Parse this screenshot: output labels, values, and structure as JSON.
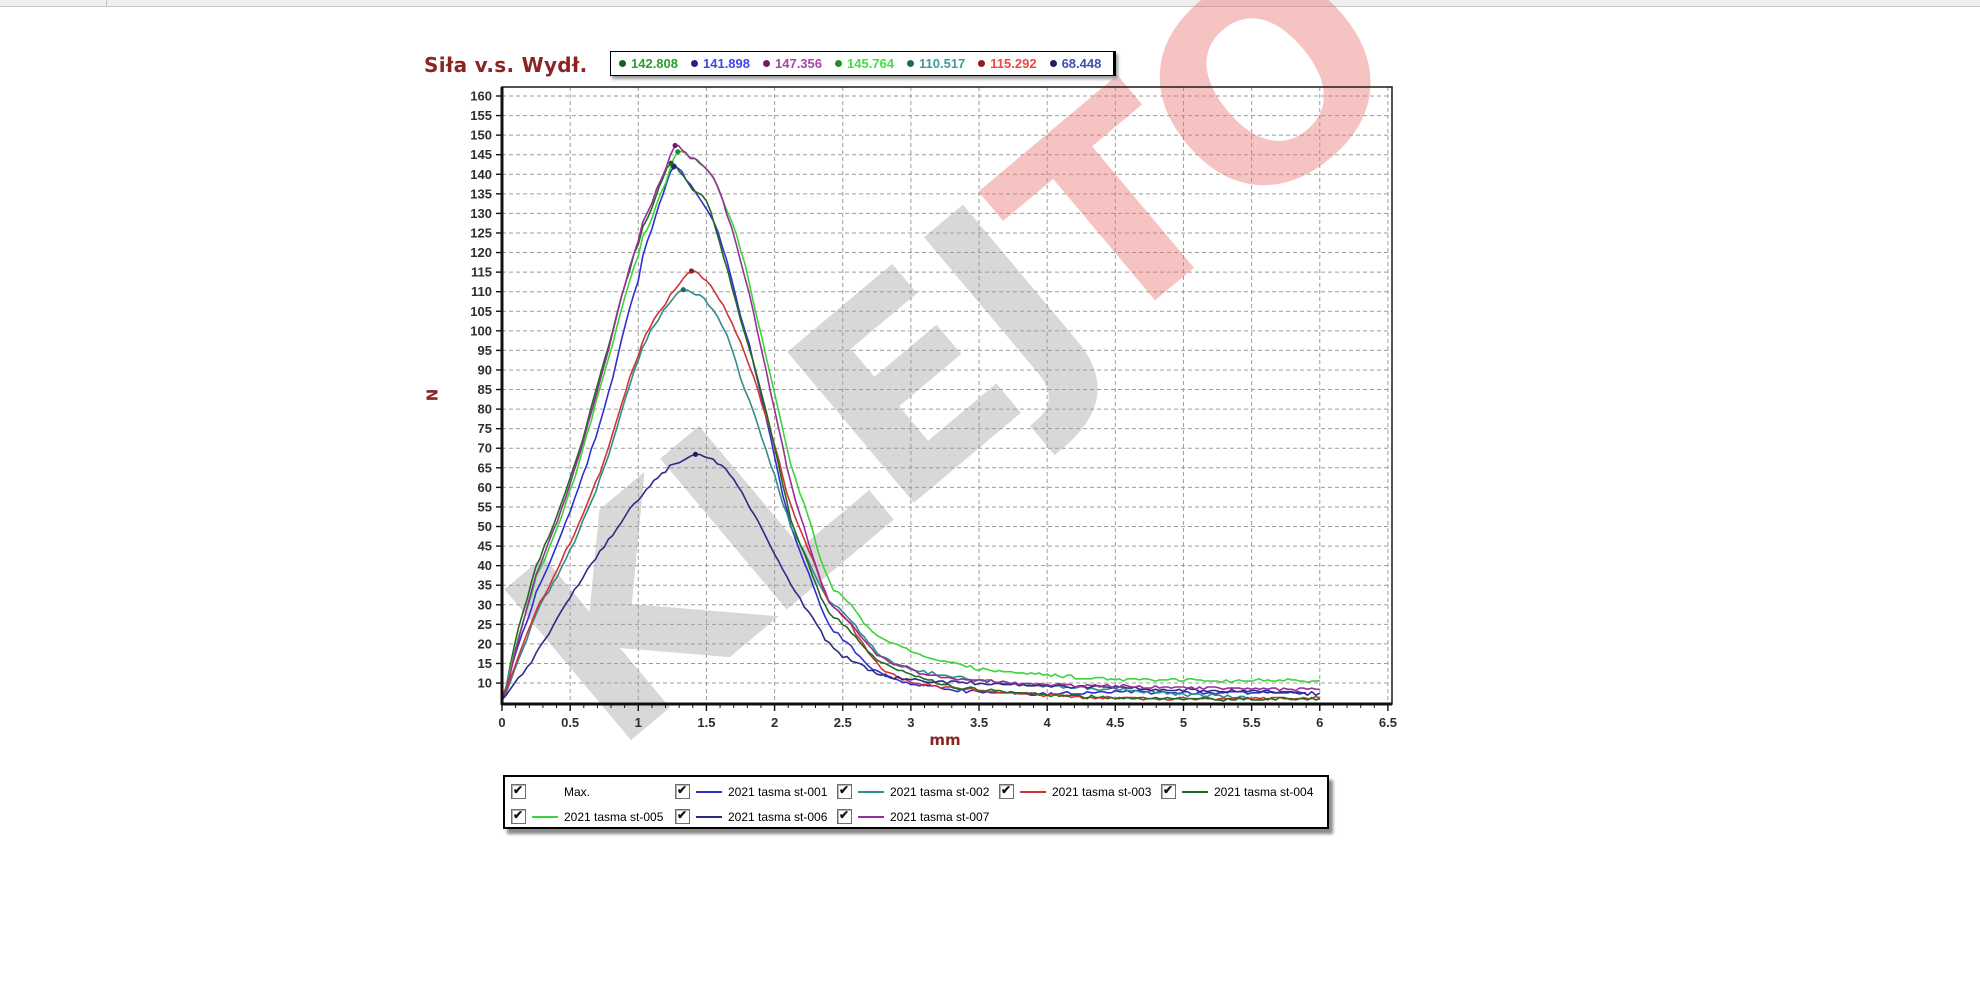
{
  "title": "Siła v.s. Wydł.",
  "axes": {
    "y_label": "N",
    "x_label": "mm"
  },
  "watermark": {
    "gray": "KLEJ",
    "red": "TO",
    "gray_color": "rgba(158,158,158,0.40)",
    "red_color": "rgba(234,112,112,0.42)"
  },
  "top_legend": {
    "items": [
      {
        "value": "142.808",
        "color": "#2aa02a",
        "dot": "#1f5c1f"
      },
      {
        "value": "141.898",
        "color": "#4343f0",
        "dot": "#20208f"
      },
      {
        "value": "147.356",
        "color": "#a846a8",
        "dot": "#6a1f6a"
      },
      {
        "value": "145.764",
        "color": "#3fe23f",
        "dot": "#1f8f1f"
      },
      {
        "value": "110.517",
        "color": "#3f9c9c",
        "dot": "#1f6666"
      },
      {
        "value": "115.292",
        "color": "#f04545",
        "dot": "#8f1f1f"
      },
      {
        "value": "68.448",
        "color": "#3e4fae",
        "dot": "#20205c"
      }
    ]
  },
  "bottom_legend": {
    "items": [
      {
        "label": "Max.",
        "checked": true,
        "color": null,
        "row": 1,
        "col": 1
      },
      {
        "label": "2021 tasma st-001",
        "checked": true,
        "color": "#3030d0",
        "row": 1,
        "col": 2
      },
      {
        "label": "2021 tasma st-002",
        "checked": true,
        "color": "#338b8b",
        "row": 1,
        "col": 3
      },
      {
        "label": "2021 tasma st-003",
        "checked": true,
        "color": "#d03434",
        "row": 1,
        "col": 4
      },
      {
        "label": "2021 tasma st-004",
        "checked": true,
        "color": "#226b22",
        "row": 1,
        "col": 5
      },
      {
        "label": "2021 tasma st-005",
        "checked": true,
        "color": "#3bd43b",
        "row": 2,
        "col": 1
      },
      {
        "label": "2021 tasma st-006",
        "checked": true,
        "color": "#2c2c86",
        "row": 2,
        "col": 2
      },
      {
        "label": "2021 tasma st-007",
        "checked": true,
        "color": "#963096",
        "row": 2,
        "col": 3
      }
    ]
  },
  "chart_data": {
    "type": "line",
    "title": "Siła v.s. Wydł.",
    "xlabel": "mm",
    "ylabel": "N",
    "xlim": [
      0,
      6.53
    ],
    "ylim": [
      4.65,
      162.3
    ],
    "grid": true,
    "x_ticks": [
      0,
      0.5,
      1,
      1.5,
      2,
      2.5,
      3,
      3.5,
      4,
      4.5,
      5,
      5.5,
      6,
      6.5
    ],
    "y_ticks": [
      160,
      155,
      150,
      145,
      140,
      135,
      130,
      125,
      120,
      115,
      110,
      105,
      100,
      95,
      90,
      85,
      80,
      75,
      70,
      65,
      60,
      55,
      50,
      45,
      40,
      35,
      30,
      25,
      20,
      15,
      10
    ],
    "series": [
      {
        "name": "2021 tasma st-001",
        "color": "#3030d0",
        "dot": "#20208f",
        "max": 141.898,
        "max_at": 1.26,
        "points": [
          [
            0,
            6
          ],
          [
            0.12,
            20
          ],
          [
            0.25,
            33
          ],
          [
            0.5,
            54
          ],
          [
            0.75,
            80
          ],
          [
            1.0,
            113
          ],
          [
            1.1,
            126
          ],
          [
            1.18,
            135
          ],
          [
            1.26,
            141.9
          ],
          [
            1.35,
            139
          ],
          [
            1.45,
            134
          ],
          [
            1.55,
            128
          ],
          [
            1.65,
            118
          ],
          [
            1.75,
            104
          ],
          [
            1.85,
            91
          ],
          [
            2.0,
            68
          ],
          [
            2.12,
            50
          ],
          [
            2.25,
            38
          ],
          [
            2.4,
            25
          ],
          [
            2.5,
            21
          ],
          [
            2.75,
            13
          ],
          [
            3.0,
            9.9
          ],
          [
            3.25,
            8.6
          ],
          [
            3.5,
            7.7
          ],
          [
            4.0,
            7.2
          ],
          [
            4.5,
            7.8
          ],
          [
            5.0,
            7.5
          ],
          [
            5.5,
            7.7
          ],
          [
            5.9,
            7.5
          ]
        ]
      },
      {
        "name": "2021 tasma st-002",
        "color": "#338b8b",
        "dot": "#1f6666",
        "max": 110.517,
        "max_at": 1.33,
        "points": [
          [
            0,
            5.8
          ],
          [
            0.12,
            16
          ],
          [
            0.25,
            28
          ],
          [
            0.5,
            44
          ],
          [
            0.75,
            65
          ],
          [
            1.0,
            92
          ],
          [
            1.15,
            103
          ],
          [
            1.25,
            108
          ],
          [
            1.33,
            110.5
          ],
          [
            1.45,
            109
          ],
          [
            1.55,
            105
          ],
          [
            1.65,
            99
          ],
          [
            1.75,
            88
          ],
          [
            1.875,
            76
          ],
          [
            2.0,
            63
          ],
          [
            2.12,
            50
          ],
          [
            2.25,
            41
          ],
          [
            2.4,
            31
          ],
          [
            2.5,
            28
          ],
          [
            2.75,
            18
          ],
          [
            3.0,
            13.7
          ],
          [
            3.25,
            12
          ],
          [
            3.5,
            10.7
          ],
          [
            4.0,
            9.3
          ],
          [
            4.5,
            8.4
          ],
          [
            5.0,
            7.2
          ],
          [
            5.5,
            6.2
          ]
        ]
      },
      {
        "name": "2021 tasma st-003",
        "color": "#d03434",
        "dot": "#8f1f1f",
        "max": 115.292,
        "max_at": 1.39,
        "points": [
          [
            0,
            5.8
          ],
          [
            0.12,
            17
          ],
          [
            0.25,
            29
          ],
          [
            0.5,
            46
          ],
          [
            0.75,
            67
          ],
          [
            1.0,
            94
          ],
          [
            1.2,
            107
          ],
          [
            1.3,
            112
          ],
          [
            1.39,
            115.3
          ],
          [
            1.5,
            112.5
          ],
          [
            1.625,
            106
          ],
          [
            1.75,
            97
          ],
          [
            1.875,
            85
          ],
          [
            2.0,
            71
          ],
          [
            2.12,
            55
          ],
          [
            2.25,
            44
          ],
          [
            2.4,
            31
          ],
          [
            2.5,
            27
          ],
          [
            2.75,
            15
          ],
          [
            3.0,
            10.3
          ],
          [
            3.25,
            9
          ],
          [
            3.5,
            8.1
          ],
          [
            4.0,
            6.9
          ],
          [
            4.5,
            6.1
          ],
          [
            5.0,
            5.9
          ],
          [
            5.5,
            6.1
          ],
          [
            6.0,
            6.1
          ]
        ]
      },
      {
        "name": "2021 tasma st-004",
        "color": "#226b22",
        "dot": "#1f5c1f",
        "max": 142.808,
        "max_at": 1.24,
        "points": [
          [
            0,
            6
          ],
          [
            0.12,
            24
          ],
          [
            0.25,
            40
          ],
          [
            0.5,
            62
          ],
          [
            0.75,
            92
          ],
          [
            1.0,
            122
          ],
          [
            1.1,
            131
          ],
          [
            1.18,
            139
          ],
          [
            1.24,
            142.8
          ],
          [
            1.3,
            141
          ],
          [
            1.4,
            136
          ],
          [
            1.5,
            133
          ],
          [
            1.625,
            119
          ],
          [
            1.75,
            103
          ],
          [
            1.875,
            88
          ],
          [
            2.0,
            70
          ],
          [
            2.12,
            52
          ],
          [
            2.25,
            40
          ],
          [
            2.4,
            28
          ],
          [
            2.5,
            25
          ],
          [
            2.75,
            16
          ],
          [
            3.0,
            12.5
          ],
          [
            3.25,
            9.6
          ],
          [
            3.5,
            8.2
          ],
          [
            4.0,
            7.0
          ],
          [
            4.5,
            6.2
          ],
          [
            5.0,
            6.0
          ],
          [
            5.5,
            5.9
          ],
          [
            6.0,
            6.0
          ]
        ]
      },
      {
        "name": "2021 tasma st-005",
        "color": "#3bd43b",
        "dot": "#1f8f1f",
        "max": 145.764,
        "max_at": 1.29,
        "points": [
          [
            0,
            5.9
          ],
          [
            0.12,
            22
          ],
          [
            0.25,
            37
          ],
          [
            0.5,
            59
          ],
          [
            0.75,
            89
          ],
          [
            1.0,
            119
          ],
          [
            1.1,
            129
          ],
          [
            1.2,
            138
          ],
          [
            1.29,
            145.8
          ],
          [
            1.4,
            144
          ],
          [
            1.5,
            141.5
          ],
          [
            1.625,
            133
          ],
          [
            1.75,
            121
          ],
          [
            1.875,
            103
          ],
          [
            2.0,
            84
          ],
          [
            2.12,
            66
          ],
          [
            2.25,
            52
          ],
          [
            2.4,
            36
          ],
          [
            2.5,
            32
          ],
          [
            2.75,
            22
          ],
          [
            3.0,
            18.4
          ],
          [
            3.25,
            15.5
          ],
          [
            3.5,
            13.7
          ],
          [
            4.0,
            12.0
          ],
          [
            4.5,
            10.9
          ],
          [
            5.0,
            10.8
          ],
          [
            5.25,
            10.4
          ],
          [
            5.5,
            10.7
          ],
          [
            6.0,
            10.6
          ]
        ]
      },
      {
        "name": "2021 tasma st-006",
        "color": "#2c2c86",
        "dot": "#20205c",
        "max": 68.448,
        "max_at": 1.42,
        "points": [
          [
            0,
            5.8
          ],
          [
            0.12,
            11
          ],
          [
            0.25,
            18
          ],
          [
            0.5,
            32
          ],
          [
            0.75,
            45
          ],
          [
            1.0,
            57
          ],
          [
            1.2,
            64
          ],
          [
            1.3,
            66.5
          ],
          [
            1.42,
            68.4
          ],
          [
            1.55,
            67
          ],
          [
            1.7,
            62
          ],
          [
            1.85,
            53
          ],
          [
            2.0,
            43
          ],
          [
            2.12,
            35
          ],
          [
            2.25,
            28
          ],
          [
            2.4,
            20
          ],
          [
            2.5,
            17
          ],
          [
            2.75,
            12.5
          ],
          [
            3.0,
            10.8
          ],
          [
            3.5,
            10.0
          ],
          [
            4.0,
            9.3
          ],
          [
            4.5,
            8.9
          ],
          [
            5.0,
            8.2
          ],
          [
            5.5,
            7.8
          ],
          [
            6.0,
            7.4
          ]
        ]
      },
      {
        "name": "2021 tasma st-007",
        "color": "#963096",
        "dot": "#6a1f6a",
        "max": 147.356,
        "max_at": 1.27,
        "points": [
          [
            0,
            5.9
          ],
          [
            0.12,
            21
          ],
          [
            0.25,
            38
          ],
          [
            0.5,
            61
          ],
          [
            0.75,
            91
          ],
          [
            1.0,
            123
          ],
          [
            1.1,
            133
          ],
          [
            1.2,
            141
          ],
          [
            1.27,
            147.4
          ],
          [
            1.35,
            145
          ],
          [
            1.45,
            143
          ],
          [
            1.55,
            139
          ],
          [
            1.65,
            130
          ],
          [
            1.75,
            118
          ],
          [
            1.875,
            100
          ],
          [
            2.0,
            80
          ],
          [
            2.12,
            61
          ],
          [
            2.25,
            46
          ],
          [
            2.4,
            31
          ],
          [
            2.5,
            27.5
          ],
          [
            2.75,
            17.5
          ],
          [
            3.0,
            13.3
          ],
          [
            3.25,
            11.5
          ],
          [
            3.5,
            10.5
          ],
          [
            4.0,
            9.6
          ],
          [
            4.5,
            9.2
          ],
          [
            5.0,
            8.8
          ],
          [
            5.5,
            8.5
          ],
          [
            6.0,
            8.4
          ]
        ]
      }
    ]
  }
}
